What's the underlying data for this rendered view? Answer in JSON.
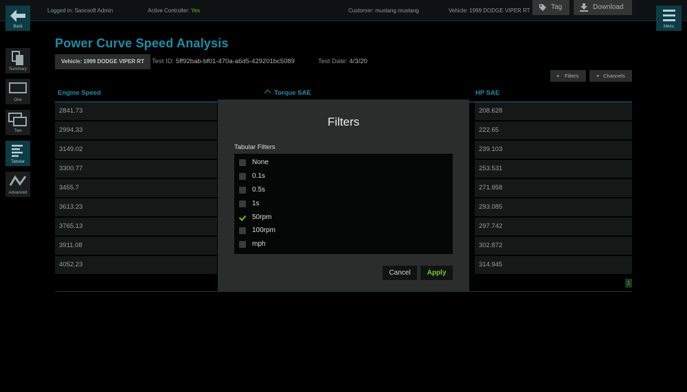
{
  "header": {
    "logged_in": "Logged in: Sancsoft Admin",
    "active_controller_label": "Active Controller:",
    "active_controller_value": "Yes",
    "customer": "Customer: mustang mustang",
    "vehicle": "Vehicle: 1999 DODGE VIPER RT"
  },
  "nav": {
    "back_label": "Back",
    "menu_label": "Menu",
    "sidebar": [
      {
        "label": "Summary",
        "icon": "document-icon"
      },
      {
        "label": "One",
        "icon": "single-window-icon"
      },
      {
        "label": "Two",
        "icon": "double-window-icon"
      },
      {
        "label": "Tabular",
        "icon": "table-lines-icon",
        "active": true
      },
      {
        "label": "Advanced",
        "icon": "wave-chart-icon"
      }
    ]
  },
  "page": {
    "title": "Power Curve Speed Analysis",
    "vehicle_pill": "Vehicle: 1999 DODGE VIPER RT",
    "test_id_label": "Test ID:",
    "test_id_value": "5ff92bab-bf01-470a-a6d5-429201bc5089",
    "test_date_label": "Test Date:",
    "test_date_value": "4/3/20",
    "tag_label": "Tag",
    "download_label": "Download",
    "filters_label": "Filters",
    "channels_label": "Channels"
  },
  "table": {
    "columns": [
      "Engine Speed",
      "Torque SAE",
      "HP SAE"
    ],
    "rows": [
      [
        "2841.73",
        "208.628"
      ],
      [
        "2994.33",
        "222.65"
      ],
      [
        "3149.02",
        "239.103"
      ],
      [
        "3300.77",
        "253.531"
      ],
      [
        "3455.7",
        "271.958"
      ],
      [
        "3613.23",
        "293.085"
      ],
      [
        "3765.13",
        "297.742"
      ],
      [
        "3911.08",
        "302.872"
      ],
      [
        "4052.23",
        "314.945"
      ]
    ],
    "page_number": "1"
  },
  "modal": {
    "title": "Filters",
    "section_label": "Tabular Filters",
    "options": [
      {
        "label": "None",
        "checked": false
      },
      {
        "label": "0.1s",
        "checked": false
      },
      {
        "label": "0.5s",
        "checked": false
      },
      {
        "label": "1s",
        "checked": false
      },
      {
        "label": "50rpm",
        "checked": true
      },
      {
        "label": "100rpm",
        "checked": false
      },
      {
        "label": "mph",
        "checked": false
      }
    ],
    "cancel_label": "Cancel",
    "apply_label": "Apply"
  },
  "colors": {
    "accent": "#1d8fa8",
    "nav_active": "#0d3c44",
    "success": "#6fd020"
  }
}
